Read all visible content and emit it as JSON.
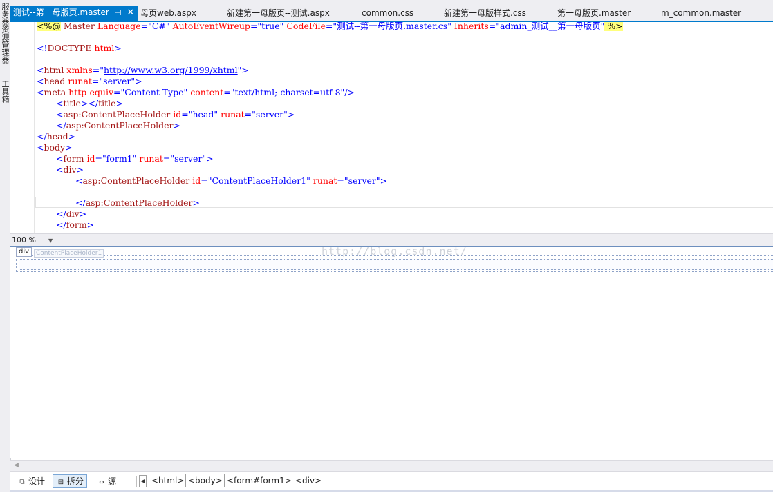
{
  "left_rail": {
    "items": [
      "服务器资源管理器",
      "工具箱"
    ]
  },
  "tabs": [
    {
      "label": "测试--第一母版页.master",
      "active": true
    },
    {
      "label": "母页web.aspx"
    },
    {
      "label": "新建第一母版页--测试.aspx"
    },
    {
      "label": "common.css"
    },
    {
      "label": "新建第一母版样式.css"
    },
    {
      "label": "第一母版页.master"
    },
    {
      "label": "m_common.master"
    }
  ],
  "tab_icons": {
    "pin": "pin-icon",
    "close": "close-icon"
  },
  "code": {
    "l1": {
      "open": "<%@",
      "w1": " Master ",
      "a1": "Language",
      "e1": "=",
      "v1": "\"C#\"",
      "a2": " AutoEventWireup",
      "e2": "=",
      "v2": "\"true\"",
      "a3": " CodeFile",
      "e3": "=",
      "v3": "\"测试--第一母版页.master.cs\"",
      "a4": " Inherits",
      "e4": "=",
      "v4": "\"admin_测试__第一母版页\"",
      "close": " %>"
    },
    "l3": {
      "p": "<!",
      "t": "DOCTYPE",
      "r": " html",
      "c": ">"
    },
    "l5": {
      "p": "<",
      "t": "html",
      "a": " xmlns",
      "e": "=",
      "q1": "\"",
      "url": "http://www.w3.org/1999/xhtml",
      "q2": "\"",
      "c": ">"
    },
    "l6": {
      "p": "<",
      "t": "head",
      "a": " runat",
      "e": "=",
      "v": "\"server\"",
      "c": ">"
    },
    "l7": {
      "p": "<",
      "t": "meta",
      "a1": " http-equiv",
      "e1": "=",
      "v1": "\"Content-Type\"",
      "a2": " content",
      "e2": "=",
      "v2": "\"text/html; charset=utf-8\"",
      "c": "/>"
    },
    "l8": {
      "p": "<",
      "t": "title",
      "m": "></",
      "t2": "title",
      "c": ">"
    },
    "l9": {
      "p": "<",
      "t": "asp:ContentPlaceHolder",
      "a1": " id",
      "e1": "=",
      "v1": "\"head\"",
      "a2": " runat",
      "e2": "=",
      "v2": "\"server\"",
      "c": ">"
    },
    "l10": {
      "p": "</",
      "t": "asp:ContentPlaceHolder",
      "c": ">"
    },
    "l11": {
      "p": "</",
      "t": "head",
      "c": ">"
    },
    "l12": {
      "p": "<",
      "t": "body",
      "c": ">"
    },
    "l13": {
      "p": "<",
      "t": "form",
      "a1": " id",
      "e1": "=",
      "v1": "\"form1\"",
      "a2": " runat",
      "e2": "=",
      "v2": "\"server\"",
      "c": ">"
    },
    "l14": {
      "p": "<",
      "t": "div",
      "c": ">"
    },
    "l15": {
      "p": "<",
      "t": "asp:ContentPlaceHolder",
      "a1": " id",
      "e1": "=",
      "v1": "\"ContentPlaceHolder1\"",
      "a2": " runat",
      "e2": "=",
      "v2": "\"server\"",
      "c": ">"
    },
    "l17": {
      "p": "</",
      "t": "asp:ContentPlaceHolder",
      "c": ">"
    },
    "l18": {
      "p": "</",
      "t": "div",
      "c": ">"
    },
    "l19": {
      "p": "</",
      "t": "form",
      "c": ">"
    },
    "l20": {
      "p": "</",
      "t": "body",
      "c": ">"
    }
  },
  "zoom": {
    "value": "100 %"
  },
  "design": {
    "tag_label": "div",
    "placeholder_label": "ContentPlaceHolder1",
    "watermark": "http://blog.csdn.net/"
  },
  "view_buttons": {
    "design": "设计",
    "split": "拆分",
    "source": "源",
    "selected": "split"
  },
  "breadcrumbs": [
    "<html>",
    "<body>",
    "<form#form1>",
    "<div>"
  ],
  "colors": {
    "accent": "#007acc",
    "tag": "#a31515",
    "attr": "#ff0000",
    "value": "#0000ff"
  }
}
